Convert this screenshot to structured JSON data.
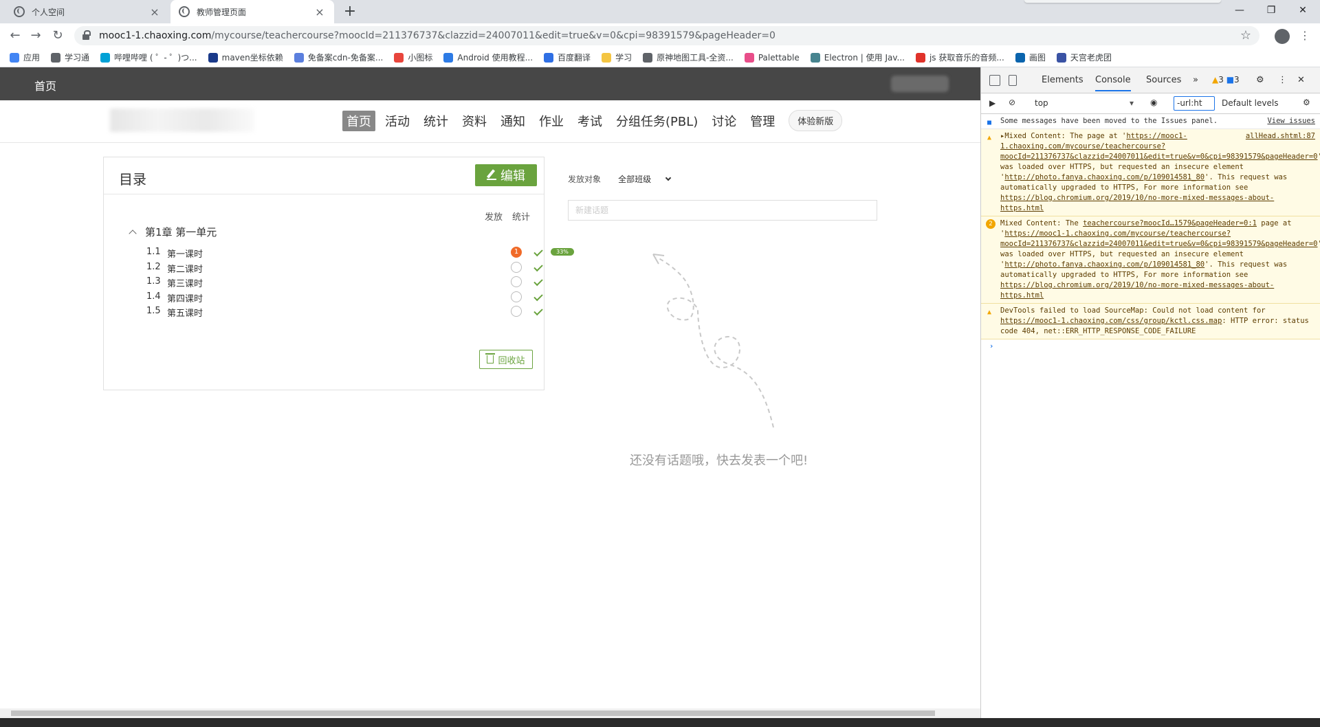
{
  "browser": {
    "tabs": [
      {
        "title": "个人空间",
        "active": false
      },
      {
        "title": "教师管理页面",
        "active": true
      }
    ],
    "url_host": "mooc1-1.chaoxing.com",
    "url_path": "/mycourse/teachercourse?moocId=211376737&clazzid=24007011&edit=true&v=0&cpi=98391579&pageHeader=0",
    "bookmarks": [
      {
        "label": "应用",
        "color": "#4285f4"
      },
      {
        "label": "学习通",
        "color": "#5f6368"
      },
      {
        "label": "哔哩哔哩 ( ゜- ゜)つ...",
        "color": "#00a1d6"
      },
      {
        "label": "maven坐标依赖",
        "color": "#1a3a8a"
      },
      {
        "label": "免备案cdn-免备案...",
        "color": "#5b7fde"
      },
      {
        "label": "小图标",
        "color": "#e8453c"
      },
      {
        "label": "Android 使用教程...",
        "color": "#2d7be5"
      },
      {
        "label": "百度翻译",
        "color": "#2f6fe4"
      },
      {
        "label": "学习",
        "color": "#f4c542"
      },
      {
        "label": "原神地图工具-全资...",
        "color": "#5f6368"
      },
      {
        "label": "Palettable",
        "color": "#e84e89"
      },
      {
        "label": "Electron | 使用 Jav...",
        "color": "#47848f"
      },
      {
        "label": "js 获取音乐的音频...",
        "color": "#e0322a"
      },
      {
        "label": "画图",
        "color": "#0a64ad"
      },
      {
        "label": "天宫老虎团",
        "color": "#3a53a4"
      }
    ]
  },
  "page": {
    "top_home": "首页",
    "nav": [
      "首页",
      "活动",
      "统计",
      "资料",
      "通知",
      "作业",
      "考试",
      "分组任务(PBL)",
      "讨论",
      "管理"
    ],
    "new_version": "体验新版",
    "catalog": {
      "title": "目录",
      "edit": "编辑",
      "col_publish": "发放",
      "col_stats": "统计",
      "chapter": "第1章 第一单元",
      "lessons": [
        {
          "num": "1.1",
          "name": "第一课时",
          "badge": "1",
          "progress": "33%"
        },
        {
          "num": "1.2",
          "name": "第二课时"
        },
        {
          "num": "1.3",
          "name": "第三课时"
        },
        {
          "num": "1.4",
          "name": "第四课时"
        },
        {
          "num": "1.5",
          "name": "第五课时"
        }
      ],
      "recycle": "回收站"
    },
    "discussion": {
      "target_label": "发放对象",
      "target_value": "全部班级",
      "topic_placeholder": "新建话题",
      "empty_text": "还没有话题哦，快去发表一个吧!"
    }
  },
  "devtools": {
    "tabs": [
      "Elements",
      "Console",
      "Sources"
    ],
    "active_tab": "Console",
    "warn_count": "3",
    "msg_count": "3",
    "context": "top",
    "filter": "-url:ht",
    "levels": "Default levels",
    "messages": {
      "info_text": "Some messages have been moved to the Issues panel.",
      "info_link": "View issues",
      "m1_prefix": "▸Mixed Content: The page at '",
      "m1_link1": "https://mooc1-1.chaoxing.com/mycourse/teachercourse?moocId=211376737&clazzid=24007011&edit=true&v=0&cpi=98391579&pageHeader=0",
      "m1_src": "allHead.shtml:87",
      "m1_mid": "' was loaded over HTTPS, but requested an insecure element '",
      "m1_link2": "http://photo.fanya.chaoxing.com/p/109014581_80",
      "m1_end": "'. This request was automatically upgraded to HTTPS, For more information see ",
      "m1_link3": "https://blog.chromium.org/2019/10/no-more-mixed-messages-about-https.html",
      "m2_badge": "2",
      "m2_prefix": "Mixed Content: The ",
      "m2_src": "teachercourse?moocId…1579&pageHeader=0:1",
      "m2_page": " page at '",
      "m2_link1": "https://mooc1-1.chaoxing.com/mycourse/teachercourse?moocId=211376737&clazzid=24007011&edit=true&v=0&cpi=98391579&pageHeader=0",
      "m2_mid": "' was loaded over HTTPS, but requested an insecure element '",
      "m2_link2": "http://photo.fanya.chaoxing.com/p/109014581_80",
      "m2_end": "'. This request was automatically upgraded to HTTPS, For more information see ",
      "m2_link3": "https://blog.chromium.org/2019/10/no-more-mixed-messages-about-https.html",
      "m3_prefix": "DevTools failed to load SourceMap: Could not load content for ",
      "m3_link": "https://mooc1-1.chaoxing.com/css/group/kctl.css.map",
      "m3_end": ": HTTP error: status code 404, net::ERR_HTTP_RESPONSE_CODE_FAILURE"
    }
  },
  "colors": {
    "accent_green": "#6aa33e",
    "badge_orange": "#f06a28",
    "topbar": "#474747",
    "devtools_link": "#1a73e8"
  }
}
